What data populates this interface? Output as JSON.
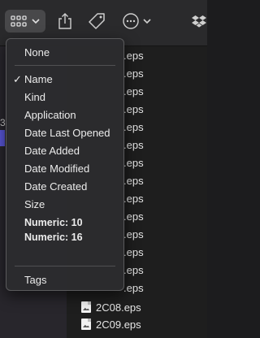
{
  "toolbar": {
    "icons": [
      "group-view-icon",
      "chevron-down-icon",
      "share-icon",
      "tag-icon",
      "more-icon",
      "chevron-down-icon",
      "dropbox-icon"
    ]
  },
  "menu": {
    "none": "None",
    "checkmark": "✓",
    "items": [
      "Name",
      "Kind",
      "Application",
      "Date Last Opened",
      "Date Added",
      "Date Modified",
      "Date Created",
      "Size"
    ],
    "numeric": [
      "Numeric: 10",
      "Numeric: 16"
    ],
    "tags": "Tags"
  },
  "files": {
    "fragment": ".eps",
    "names": [
      "2C08.eps",
      "2C09.eps"
    ]
  },
  "leftbar": {
    "fragment": "3"
  }
}
